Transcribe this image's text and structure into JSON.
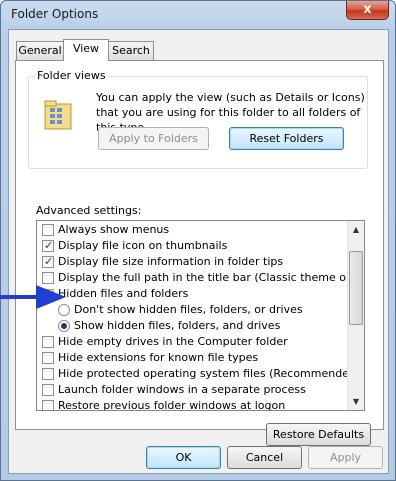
{
  "window": {
    "title": "Folder Options",
    "close_glyph": "x"
  },
  "tabs": [
    {
      "label": "General",
      "active": false
    },
    {
      "label": "View",
      "active": true
    },
    {
      "label": "Search",
      "active": false
    }
  ],
  "folder_views": {
    "label": "Folder views",
    "description": "You can apply the view (such as Details or Icons) that you are using for this folder to all folders of this type.",
    "apply_button": "Apply to Folders",
    "reset_button": "Reset Folders",
    "icon": "folder-details-icon"
  },
  "advanced": {
    "label": "Advanced settings:",
    "items": [
      {
        "type": "checkbox",
        "label": "Always show menus",
        "checked": false,
        "indent": 0
      },
      {
        "type": "checkbox",
        "label": "Display file icon on thumbnails",
        "checked": true,
        "indent": 0
      },
      {
        "type": "checkbox",
        "label": "Display file size information in folder tips",
        "checked": true,
        "indent": 0
      },
      {
        "type": "checkbox",
        "label": "Display the full path in the title bar (Classic theme only)",
        "checked": false,
        "indent": 0
      },
      {
        "type": "folder",
        "label": "Hidden files and folders",
        "indent": 0
      },
      {
        "type": "radio",
        "label": "Don't show hidden files, folders, or drives",
        "checked": false,
        "indent": 1
      },
      {
        "type": "radio",
        "label": "Show hidden files, folders, and drives",
        "checked": true,
        "indent": 1
      },
      {
        "type": "checkbox",
        "label": "Hide empty drives in the Computer folder",
        "checked": false,
        "indent": 0
      },
      {
        "type": "checkbox",
        "label": "Hide extensions for known file types",
        "checked": false,
        "indent": 0
      },
      {
        "type": "checkbox",
        "label": "Hide protected operating system files (Recommended)",
        "checked": false,
        "indent": 0
      },
      {
        "type": "checkbox",
        "label": "Launch folder windows in a separate process",
        "checked": false,
        "indent": 0
      },
      {
        "type": "checkbox",
        "label": "Restore previous folder windows at logon",
        "checked": false,
        "indent": 0
      }
    ],
    "scroll_up_glyph": "▲",
    "scroll_down_glyph": "▼",
    "check_glyph": "✓"
  },
  "restore_defaults": "Restore Defaults",
  "footer": {
    "ok": "OK",
    "cancel": "Cancel",
    "apply": "Apply"
  },
  "colors": {
    "annotation_arrow": "#1f3fd0"
  }
}
